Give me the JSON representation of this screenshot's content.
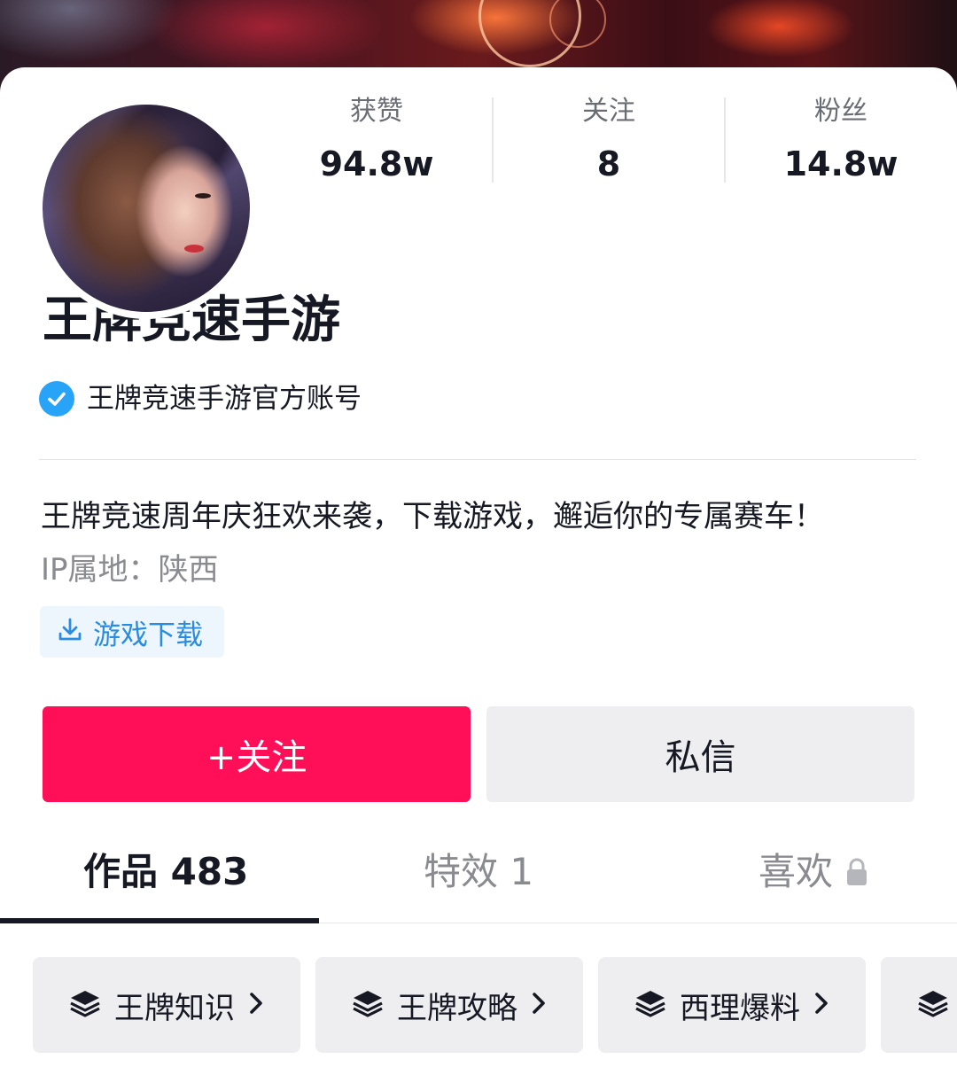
{
  "profile": {
    "name": "王牌竞速手游",
    "verified_label": "王牌竞速手游官方账号",
    "bio": "王牌竞速周年庆狂欢来袭，下载游戏，邂逅你的专属赛车！",
    "ip_location": "IP属地：陕西",
    "download_tag": "游戏下载"
  },
  "stats": [
    {
      "label": "获赞",
      "value": "94.8w"
    },
    {
      "label": "关注",
      "value": "8"
    },
    {
      "label": "粉丝",
      "value": "14.8w"
    }
  ],
  "actions": {
    "follow_label": "+关注",
    "message_label": "私信"
  },
  "tabs": [
    {
      "label": "作品 483",
      "active": true
    },
    {
      "label": "特效 1",
      "active": false
    },
    {
      "label": "喜欢",
      "active": false,
      "locked": true
    }
  ],
  "collections": [
    {
      "label": "王牌知识"
    },
    {
      "label": "王牌攻略"
    },
    {
      "label": "西理爆料"
    }
  ],
  "colors": {
    "accent": "#fe0f57",
    "verify_blue": "#27a3f7",
    "link_blue": "#2a8ce0"
  },
  "icons": [
    "verified-check-icon",
    "download-icon",
    "lock-icon",
    "layers-icon",
    "chevron-right-icon"
  ]
}
